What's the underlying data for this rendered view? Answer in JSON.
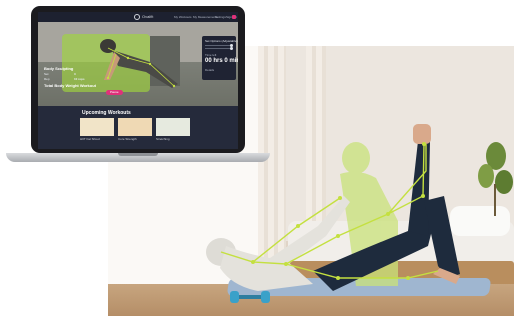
{
  "app": {
    "logo_text": "Ovalfit",
    "nav": [
      "My Workouts",
      "My Measurements",
      "Settings",
      "Sign out"
    ]
  },
  "video": {
    "stats_title": "Body Sculpting",
    "stats_rows": [
      {
        "label": "Set",
        "value": "3"
      },
      {
        "label": "Rep",
        "value": "10 reps"
      }
    ],
    "total_label": "Total Body Weight Workout",
    "pill_label": "Pause"
  },
  "panel": {
    "title": "Set Options (Adjustable)",
    "time_label": "Time left",
    "time_value": "00 hrs 0 mins",
    "footer": "Details"
  },
  "upcoming": {
    "title": "Upcoming Workouts",
    "cards": [
      {
        "caption": "HIIT Fat Shred"
      },
      {
        "caption": "Core Strength"
      },
      {
        "caption": "Stretching"
      }
    ]
  },
  "colors": {
    "accent": "#e0317a",
    "pose_overlay": "#a6d94a",
    "app_bg": "#252a3b"
  }
}
